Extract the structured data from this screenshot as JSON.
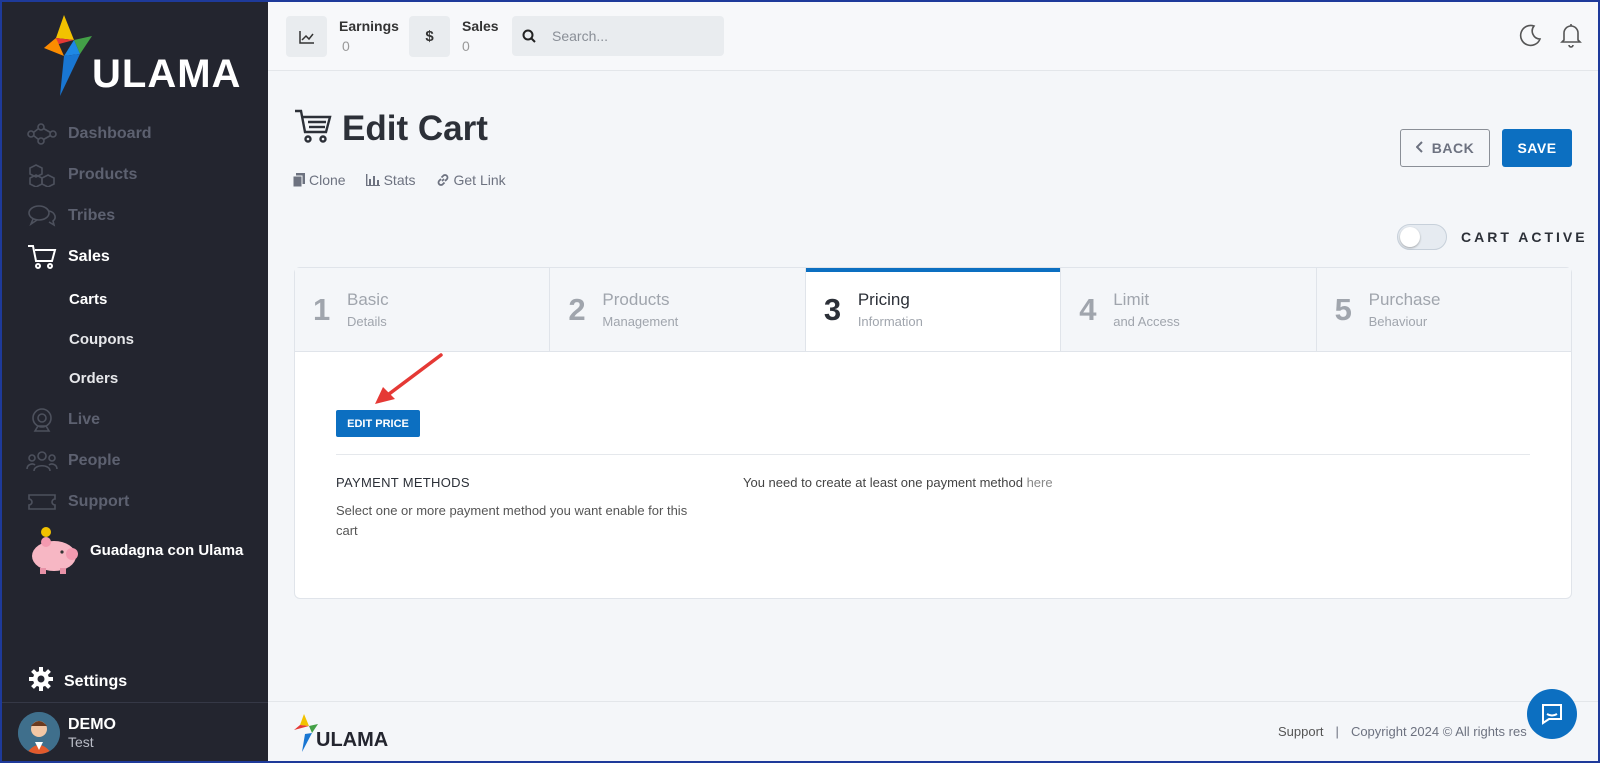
{
  "brand": {
    "name": "ULAMA",
    "colors": {
      "sidebar": "#23252f",
      "accent": "#0c6fc1"
    }
  },
  "sidebar": {
    "items": [
      {
        "label": "Dashboard",
        "icon": "network-icon"
      },
      {
        "label": "Products",
        "icon": "cubes-icon"
      },
      {
        "label": "Tribes",
        "icon": "chat-bubbles-icon"
      },
      {
        "label": "Sales",
        "icon": "cart-icon"
      },
      {
        "label": "Live",
        "icon": "webcam-icon"
      },
      {
        "label": "People",
        "icon": "people-icon"
      },
      {
        "label": "Support",
        "icon": "ticket-icon"
      }
    ],
    "sub_items": [
      "Carts",
      "Coupons",
      "Orders"
    ],
    "promo": "Guadagna con Ulama",
    "settings": "Settings",
    "user": {
      "name": "DEMO",
      "role": "Test"
    }
  },
  "topbar": {
    "earnings_label": "Earnings",
    "earnings_value": "0",
    "sales_label": "Sales",
    "sales_value": "0",
    "search_placeholder": "Search..."
  },
  "page": {
    "title": "Edit Cart",
    "links": [
      "Clone",
      "Stats",
      "Get Link"
    ],
    "back": "BACK",
    "save": "SAVE",
    "toggle_label": "CART ACTIVE"
  },
  "steps": [
    {
      "num": "1",
      "title": "Basic",
      "sub": "Details"
    },
    {
      "num": "2",
      "title": "Products",
      "sub": "Management"
    },
    {
      "num": "3",
      "title": "Pricing",
      "sub": "Information"
    },
    {
      "num": "4",
      "title": "Limit",
      "sub": "and Access"
    },
    {
      "num": "5",
      "title": "Purchase",
      "sub": "Behaviour"
    }
  ],
  "pricing": {
    "edit_price": "EDIT PRICE",
    "pm_title": "PAYMENT METHODS",
    "pm_desc": "Select one or more payment method you want enable for this cart",
    "pm_note": "You need to create at least one payment method",
    "pm_link": "here"
  },
  "footer": {
    "support": "Support",
    "sep": "|",
    "copyright": "Copyright 2024 © All rights res"
  }
}
